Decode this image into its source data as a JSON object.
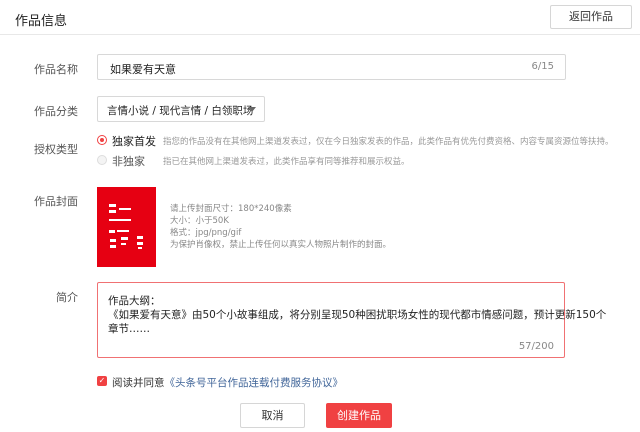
{
  "header": {
    "title": "作品信息",
    "back_label": "返回作品"
  },
  "form": {
    "name": {
      "label": "作品名称",
      "value": "如果爱有天意",
      "counter": "6/15"
    },
    "category": {
      "label": "作品分类",
      "value": "言情小说 / 现代言情 / 白领职场"
    },
    "license": {
      "label": "授权类型",
      "options": [
        {
          "label": "独家首发",
          "selected": true,
          "desc": "指您的作品没有在其他网上渠道发表过，仅在今日独家发表的作品，此类作品有优先付费资格、内容专属资源位等扶持。"
        },
        {
          "label": "非独家",
          "selected": false,
          "desc": "指已在其他网上渠道发表过，此类作品享有同等推荐和展示权益。"
        }
      ]
    },
    "cover": {
      "label": "作品封面",
      "notes": [
        "请上传封面尺寸：180*240像素",
        "大小：小于50K",
        "格式：jpg/png/gif",
        "为保护肖像权，禁止上传任何以真实人物照片制作的封面。"
      ]
    },
    "summary": {
      "label": "简介",
      "lines": [
        "作品大纲：",
        "《如果爱有天意》由50个小故事组成，将分别呈现50种困扰职场女性的现代都市情感问题，预计更新150个",
        "章节……"
      ],
      "counter": "57/200"
    },
    "agreement": {
      "checked": true,
      "prefix": "阅读并同意",
      "link": "《头条号平台作品连载付费服务协议》"
    }
  },
  "actions": {
    "cancel_label": "取消",
    "create_label": "创建作品"
  },
  "colors": {
    "accent": "#f04142",
    "link": "#406599"
  }
}
